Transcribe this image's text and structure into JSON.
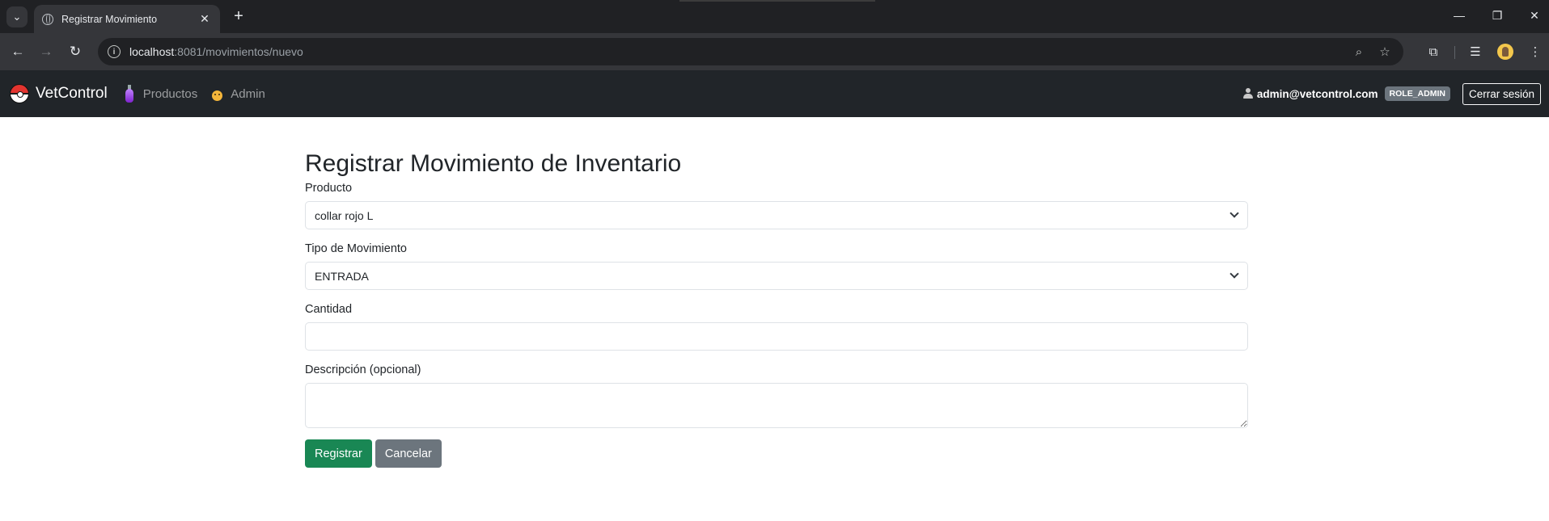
{
  "browser": {
    "tab_title": "Registrar Movimiento",
    "url_host": "localhost",
    "url_path": ":8081/movimientos/nuevo"
  },
  "navbar": {
    "brand": "VetControl",
    "links": [
      {
        "label": "Productos",
        "icon": "potion-icon"
      },
      {
        "label": "Admin",
        "icon": "admin-face-icon"
      }
    ],
    "user_email": "admin@vetcontrol.com",
    "role_badge": "ROLE_ADMIN",
    "logout_label": "Cerrar sesión"
  },
  "form": {
    "title": "Registrar Movimiento de Inventario",
    "producto_label": "Producto",
    "producto_value": "collar rojo L",
    "tipo_label": "Tipo de Movimiento",
    "tipo_value": "ENTRADA",
    "cantidad_label": "Cantidad",
    "cantidad_value": "",
    "descripcion_label": "Descripción (opcional)",
    "descripcion_value": "",
    "submit_label": "Registrar",
    "cancel_label": "Cancelar"
  },
  "colors": {
    "navbar_bg": "#212529",
    "success": "#198754",
    "secondary": "#6c757d"
  }
}
